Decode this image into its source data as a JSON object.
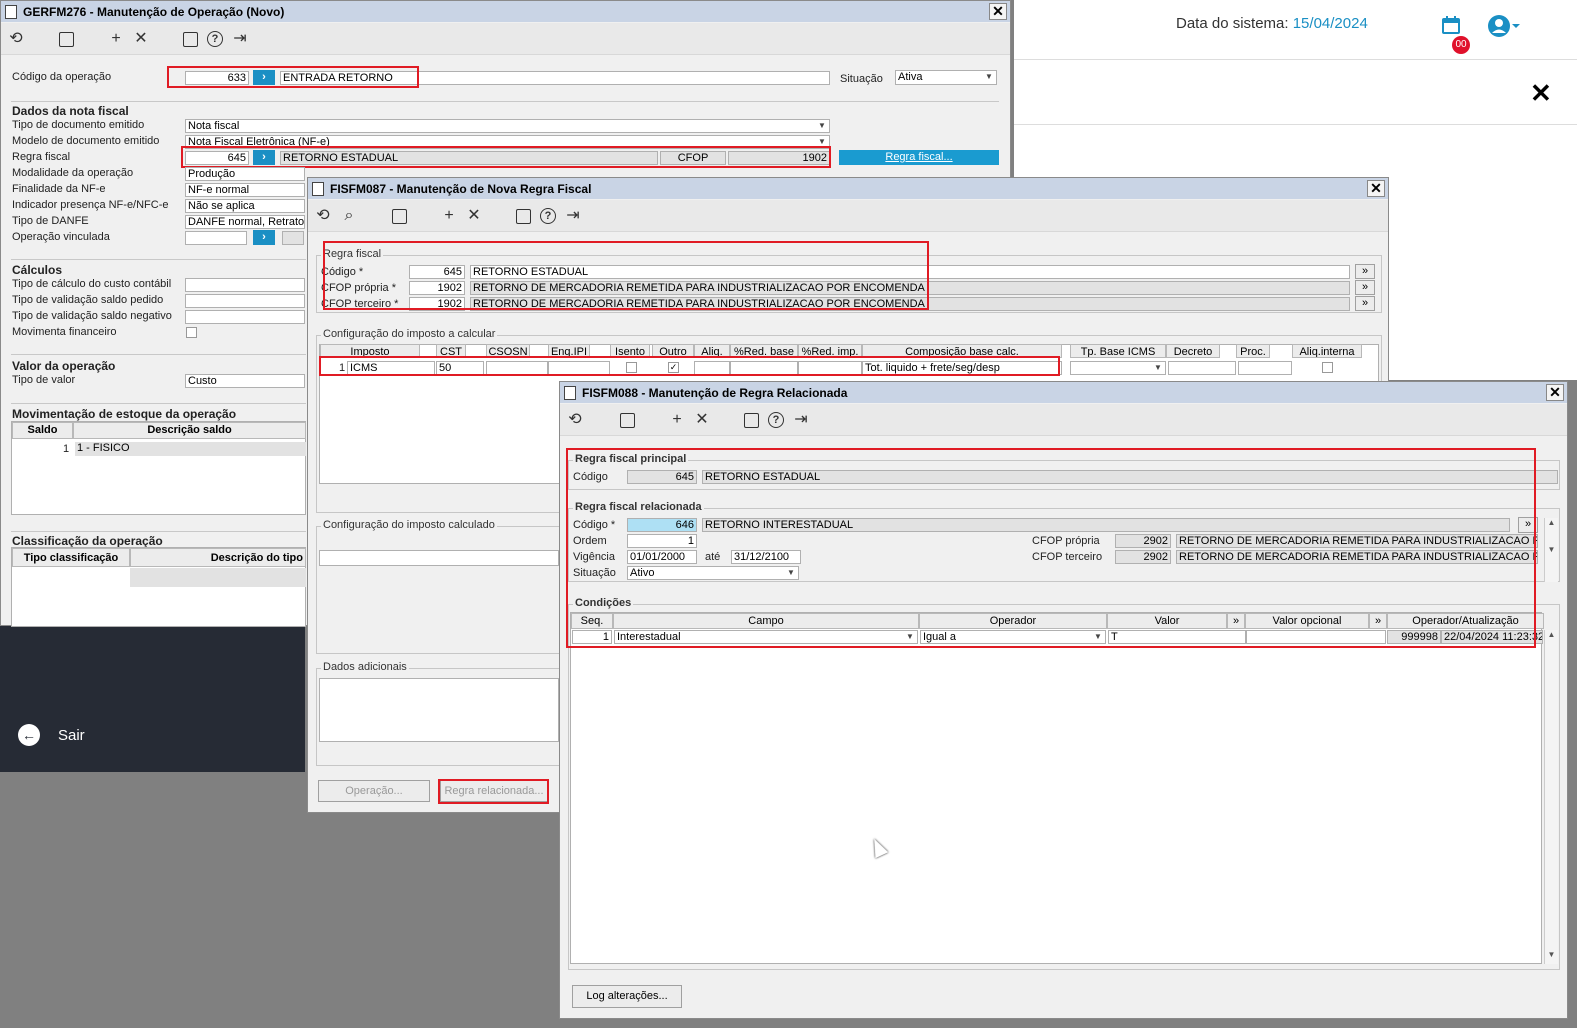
{
  "web": {
    "date_label": "Data do sistema: ",
    "date_value": "15/04/2024",
    "badge": "00",
    "sair": "Sair"
  },
  "w1": {
    "title": "GERFM276 - Manutenção de Operação (Novo)",
    "codigo_label": "Código da operação",
    "codigo_value": "633",
    "codigo_desc": "ENTRADA RETORNO",
    "situacao_label": "Situação",
    "situacao_value": "Ativa",
    "sect_nota": "Dados da nota fiscal",
    "tipo_doc_label": "Tipo de documento emitido",
    "tipo_doc_value": "Nota fiscal",
    "modelo_label": "Modelo de documento emitido",
    "modelo_value": "Nota Fiscal Eletrônica (NF-e)",
    "regra_label": "Regra fiscal",
    "regra_value": "645",
    "regra_desc": "RETORNO ESTADUAL",
    "cfop_label": "CFOP",
    "cfop_value": "1902",
    "regra_btn": "Regra fiscal...",
    "modalidade_label": "Modalidade da operação",
    "modalidade_value": "Produção",
    "finalidade_label": "Finalidade da NF-e",
    "finalidade_value": "NF-e normal",
    "indicador_label": "Indicador presença NF-e/NFC-e",
    "indicador_value": "Não se aplica",
    "danfe_label": "Tipo de DANFE",
    "danfe_value": "DANFE normal, Retrato",
    "vinculada_label": "Operação vinculada",
    "sect_calc": "Cálculos",
    "custo_label": "Tipo de cálculo do custo contábil",
    "valped_label": "Tipo de validação saldo pedido",
    "valneg_label": "Tipo de validação saldo negativo",
    "movfin_label": "Movimenta financeiro",
    "sect_valor": "Valor da operação",
    "tipovalor_label": "Tipo de valor",
    "tipovalor_value": "Custo",
    "sect_mov": "Movimentação de estoque da operação",
    "mov_cols": [
      "Saldo",
      "Descrição saldo"
    ],
    "mov_row_num": "1",
    "mov_row_desc": "1 - FISICO",
    "sect_class": "Classificação da operação",
    "class_cols": [
      "Tipo classificação",
      "Descrição do tipo"
    ]
  },
  "w2": {
    "title": "FISFM087 - Manutenção de Nova Regra Fiscal",
    "regra_leg": "Regra fiscal",
    "codigo_label": "Código *",
    "codigo_value": "645",
    "codigo_desc": "RETORNO ESTADUAL",
    "cfopp_label": "CFOP própria *",
    "cfopp_value": "1902",
    "cfopp_desc": "RETORNO DE MERCADORIA REMETIDA PARA INDUSTRIALIZACAO POR ENCOMENDA",
    "cfopt_label": "CFOP terceiro *",
    "cfopt_value": "1902",
    "cfopt_desc": "RETORNO DE MERCADORIA REMETIDA PARA INDUSTRIALIZACAO POR ENCOMENDA",
    "config_leg": "Configuração do imposto a calcular",
    "grid_cols": [
      "Imposto",
      "CST",
      "CSOSN",
      "Enq.IPI",
      "Isento",
      "Outro",
      "Aliq.",
      "%Red. base",
      "%Red. imp.",
      "Composição base calc.",
      "Tp. Base ICMS",
      "Decreto",
      "Proc.",
      "Aliq.interna"
    ],
    "row_num": "1",
    "row_imposto": "ICMS",
    "row_cst": "50",
    "row_comp": "Tot. liquido + frete/seg/desp",
    "calc_leg": "Configuração do imposto calculado",
    "adic_leg": "Dados adicionais",
    "btn_operacao": "Operação...",
    "btn_regra_rel": "Regra relacionada..."
  },
  "w3": {
    "title": "FISFM088 - Manutenção de Regra Relacionada",
    "principal_leg": "Regra fiscal principal",
    "codigo_label": "Código",
    "codigo_value": "645",
    "codigo_desc": "RETORNO ESTADUAL",
    "relac_leg": "Regra fiscal relacionada",
    "rcodigo_label": "Código *",
    "rcodigo_value": "646",
    "rcodigo_desc": "RETORNO INTERESTADUAL",
    "ordem_label": "Ordem",
    "ordem_value": "1",
    "vig_label": "Vigência",
    "vig_ini": "01/01/2000",
    "ate_label": "até",
    "vig_fim": "31/12/2100",
    "sit_label": "Situação",
    "sit_value": "Ativo",
    "cfopp_label": "CFOP própria",
    "cfopp_value": "2902",
    "cfopp_desc": "RETORNO DE MERCADORIA REMETIDA PARA INDUSTRIALIZACAO POR EN",
    "cfopt_label": "CFOP terceiro",
    "cfopt_value": "2902",
    "cfopt_desc": "RETORNO DE MERCADORIA REMETIDA PARA INDUSTRIALIZACAO POR EN",
    "cond_leg": "Condições",
    "cond_cols": [
      "Seq.",
      "Campo",
      "Operador",
      "Valor",
      "Valor opcional",
      "Operador/Atualização"
    ],
    "cond_seq": "1",
    "cond_campo": "Interestadual",
    "cond_oper": "Igual a",
    "cond_valor": "T",
    "cond_user": "999998",
    "cond_data": "22/04/2024 11:23:32",
    "log_btn": "Log alterações..."
  }
}
